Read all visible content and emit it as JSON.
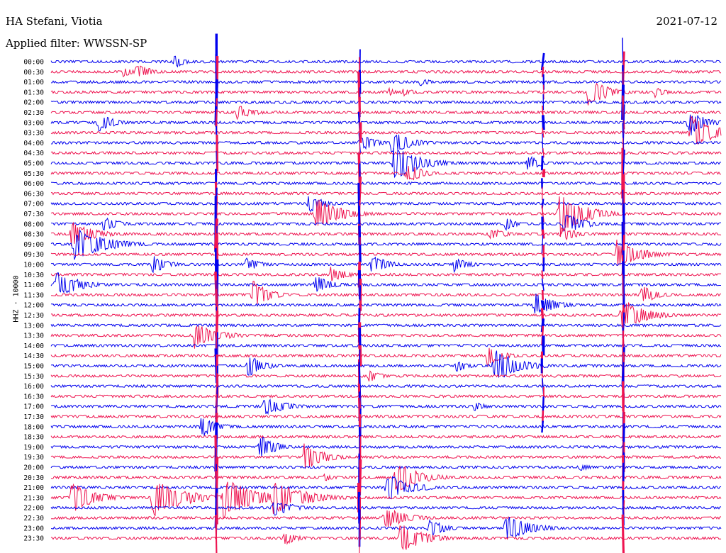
{
  "header": {
    "station": "HA Stefani, Viotia",
    "filter": "Applied filter: WWSSN-SP",
    "date": "2021-07-12"
  },
  "chart_data": {
    "type": "line",
    "title": "HA Stefani, Viotia",
    "subtitle": "Applied filter: WWSSN-SP",
    "date": "2021-07-12",
    "ylabel": "HHZ - 10000",
    "xlabel": "",
    "row_labels": [
      "00:00",
      "00:30",
      "01:00",
      "01:30",
      "02:00",
      "02:30",
      "03:00",
      "03:30",
      "04:00",
      "04:30",
      "05:00",
      "05:30",
      "06:00",
      "06:30",
      "07:00",
      "07:30",
      "08:00",
      "08:30",
      "09:00",
      "09:30",
      "10:00",
      "10:30",
      "11:00",
      "11:30",
      "12:00",
      "12:30",
      "13:00",
      "13:30",
      "14:00",
      "14:30",
      "15:00",
      "15:30",
      "16:00",
      "16:30",
      "17:00",
      "17:30",
      "18:00",
      "18:30",
      "19:00",
      "19:30",
      "20:00",
      "20:30",
      "21:00",
      "21:30",
      "22:00",
      "22:30",
      "23:00",
      "23:30"
    ],
    "row_minutes": 30,
    "series_colors": [
      "#0000ee",
      "#ee1450"
    ],
    "events": [
      {
        "row": 0,
        "minute": 5.5,
        "amp": 10,
        "dur": 1.5
      },
      {
        "row": 1,
        "minute": 3.2,
        "amp": 8,
        "dur": 1.5
      },
      {
        "row": 1,
        "minute": 3.8,
        "amp": 12,
        "dur": 2
      },
      {
        "row": 2,
        "minute": 16.5,
        "amp": 6,
        "dur": 1.5
      },
      {
        "row": 3,
        "minute": 15.7,
        "amp": 7,
        "dur": 1.5
      },
      {
        "row": 3,
        "minute": 15.1,
        "amp": 6,
        "dur": 1
      },
      {
        "row": 3,
        "minute": 24,
        "amp": 22,
        "dur": 2.5
      },
      {
        "row": 3,
        "minute": 27,
        "amp": 8,
        "dur": 1.5
      },
      {
        "row": 5,
        "minute": 8.3,
        "amp": 12,
        "dur": 2
      },
      {
        "row": 6,
        "minute": 2.1,
        "amp": 14,
        "dur": 2
      },
      {
        "row": 6,
        "minute": 28.5,
        "amp": 22,
        "dur": 2
      },
      {
        "row": 7,
        "minute": 28.6,
        "amp": 26,
        "dur": 3
      },
      {
        "row": 8,
        "minute": 13.8,
        "amp": 14,
        "dur": 2
      },
      {
        "row": 8,
        "minute": 15.2,
        "amp": 18,
        "dur": 2.5
      },
      {
        "row": 10,
        "minute": 15.3,
        "amp": 30,
        "dur": 3
      },
      {
        "row": 10,
        "minute": 21.3,
        "amp": 14,
        "dur": 1.5
      },
      {
        "row": 11,
        "minute": 15.9,
        "amp": 16,
        "dur": 2
      },
      {
        "row": 14,
        "minute": 11.5,
        "amp": 14,
        "dur": 2
      },
      {
        "row": 15,
        "minute": 11.8,
        "amp": 26,
        "dur": 3
      },
      {
        "row": 15,
        "minute": 22.7,
        "amp": 35,
        "dur": 3
      },
      {
        "row": 16,
        "minute": 2.3,
        "amp": 12,
        "dur": 2
      },
      {
        "row": 16,
        "minute": 20.3,
        "amp": 10,
        "dur": 1.5
      },
      {
        "row": 16,
        "minute": 22.9,
        "amp": 18,
        "dur": 2.5
      },
      {
        "row": 17,
        "minute": 0.9,
        "amp": 18,
        "dur": 3
      },
      {
        "row": 17,
        "minute": 19.6,
        "amp": 10,
        "dur": 2
      },
      {
        "row": 17,
        "minute": 22.8,
        "amp": 12,
        "dur": 2
      },
      {
        "row": 18,
        "minute": 1.0,
        "amp": 25,
        "dur": 4
      },
      {
        "row": 19,
        "minute": 25.3,
        "amp": 22,
        "dur": 3
      },
      {
        "row": 20,
        "minute": 4.5,
        "amp": 14,
        "dur": 2
      },
      {
        "row": 20,
        "minute": 8.7,
        "amp": 10,
        "dur": 2
      },
      {
        "row": 20,
        "minute": 14.3,
        "amp": 16,
        "dur": 2
      },
      {
        "row": 20,
        "minute": 18.0,
        "amp": 12,
        "dur": 2
      },
      {
        "row": 21,
        "minute": 12.5,
        "amp": 12,
        "dur": 2
      },
      {
        "row": 22,
        "minute": 0.2,
        "amp": 20,
        "dur": 3
      },
      {
        "row": 22,
        "minute": 11.8,
        "amp": 14,
        "dur": 2
      },
      {
        "row": 23,
        "minute": 9.0,
        "amp": 22,
        "dur": 2
      },
      {
        "row": 23,
        "minute": 26.4,
        "amp": 14,
        "dur": 2
      },
      {
        "row": 24,
        "minute": 21.6,
        "amp": 18,
        "dur": 2.5
      },
      {
        "row": 25,
        "minute": 25.5,
        "amp": 24,
        "dur": 3
      },
      {
        "row": 27,
        "minute": 6.4,
        "amp": 20,
        "dur": 3
      },
      {
        "row": 29,
        "minute": 19.5,
        "amp": 16,
        "dur": 2
      },
      {
        "row": 30,
        "minute": 8.8,
        "amp": 16,
        "dur": 2
      },
      {
        "row": 30,
        "minute": 19.8,
        "amp": 26,
        "dur": 3
      },
      {
        "row": 30,
        "minute": 18.1,
        "amp": 10,
        "dur": 1.5
      },
      {
        "row": 31,
        "minute": 14.2,
        "amp": 10,
        "dur": 1.5
      },
      {
        "row": 34,
        "minute": 9.5,
        "amp": 14,
        "dur": 3
      },
      {
        "row": 34,
        "minute": 18.9,
        "amp": 8,
        "dur": 1.5
      },
      {
        "row": 36,
        "minute": 6.7,
        "amp": 18,
        "dur": 2
      },
      {
        "row": 38,
        "minute": 9.3,
        "amp": 18,
        "dur": 2
      },
      {
        "row": 39,
        "minute": 11.3,
        "amp": 20,
        "dur": 2.5
      },
      {
        "row": 39,
        "minute": 11.6,
        "amp": 10,
        "dur": 1.5
      },
      {
        "row": 40,
        "minute": 23.6,
        "amp": 6,
        "dur": 1.5
      },
      {
        "row": 41,
        "minute": 15.4,
        "amp": 24,
        "dur": 3
      },
      {
        "row": 41,
        "minute": 12.2,
        "amp": 6,
        "dur": 1.5
      },
      {
        "row": 42,
        "minute": 15.0,
        "amp": 22,
        "dur": 3
      },
      {
        "row": 43,
        "minute": 0.9,
        "amp": 24,
        "dur": 3
      },
      {
        "row": 43,
        "minute": 4.5,
        "amp": 30,
        "dur": 4
      },
      {
        "row": 43,
        "minute": 7.7,
        "amp": 30,
        "dur": 4
      },
      {
        "row": 43,
        "minute": 9.9,
        "amp": 26,
        "dur": 4
      },
      {
        "row": 44,
        "minute": 9.9,
        "amp": 12,
        "dur": 3
      },
      {
        "row": 45,
        "minute": 14.9,
        "amp": 16,
        "dur": 3
      },
      {
        "row": 46,
        "minute": 16.9,
        "amp": 14,
        "dur": 2
      },
      {
        "row": 46,
        "minute": 20.3,
        "amp": 22,
        "dur": 3
      },
      {
        "row": 47,
        "minute": 15.6,
        "amp": 22,
        "dur": 3
      },
      {
        "row": 47,
        "minute": 10.4,
        "amp": 10,
        "dur": 2
      }
    ],
    "spikes": [
      {
        "minute": 7.4,
        "from_row": 0,
        "to_row": 47,
        "amp": 40
      },
      {
        "minute": 13.8,
        "from_row": 0,
        "to_row": 47,
        "amp": 34
      },
      {
        "minute": 25.6,
        "from_row": 0,
        "to_row": 47,
        "amp": 36
      },
      {
        "minute": 22.0,
        "from_row": 0,
        "to_row": 36,
        "amp": 14
      }
    ],
    "grid": false,
    "legend": "none"
  }
}
